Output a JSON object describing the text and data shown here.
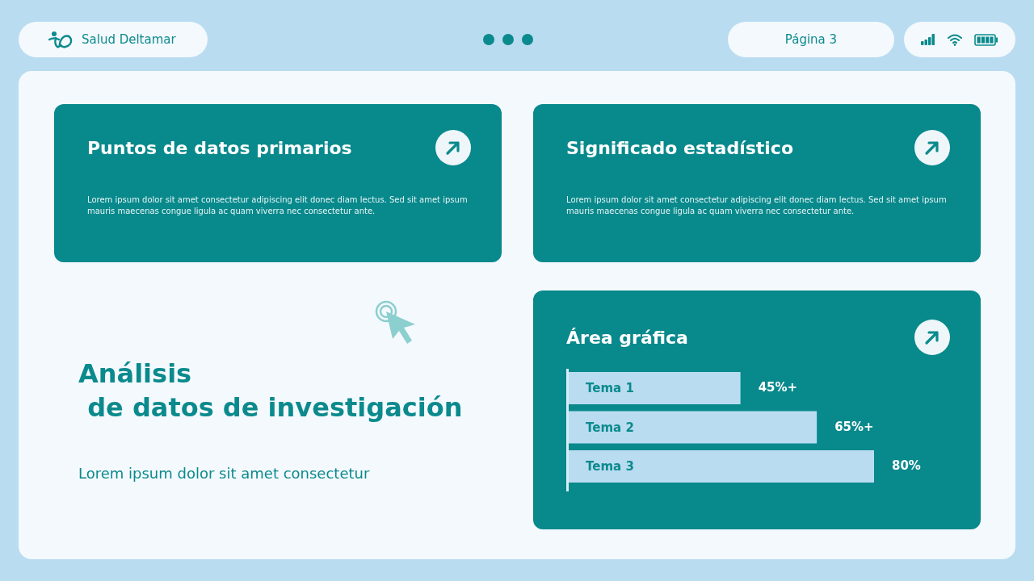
{
  "top_bar": {
    "brand": "Salud Deltamar",
    "page_label": "Página 3"
  },
  "cards": [
    {
      "title": "Puntos de datos primarios",
      "text": "Lorem ipsum dolor sit amet consectetur adipiscing elit donec diam lectus. Sed sit amet ipsum mauris maecenas congue ligula ac quam viverra nec consectetur ante."
    },
    {
      "title": "Significado estadístico",
      "text": "Lorem ipsum dolor sit amet consectetur adipiscing elit donec diam lectus. Sed sit amet ipsum mauris maecenas congue ligula ac quam viverra nec consectetur ante."
    }
  ],
  "hero": {
    "title_line_1": "Análisis",
    "title_line_2": " de datos de investigación",
    "subtitle": "Lorem ipsum dolor sit amet consectetur"
  },
  "chart_card": {
    "title": "Área gráfica",
    "chart_data": {
      "type": "bar",
      "orientation": "horizontal",
      "categories": [
        "Tema 1",
        "Tema 2",
        "Tema 3"
      ],
      "values": [
        45,
        65,
        80
      ],
      "value_labels": [
        "45%+",
        "65%+",
        "80%"
      ]
    }
  }
}
